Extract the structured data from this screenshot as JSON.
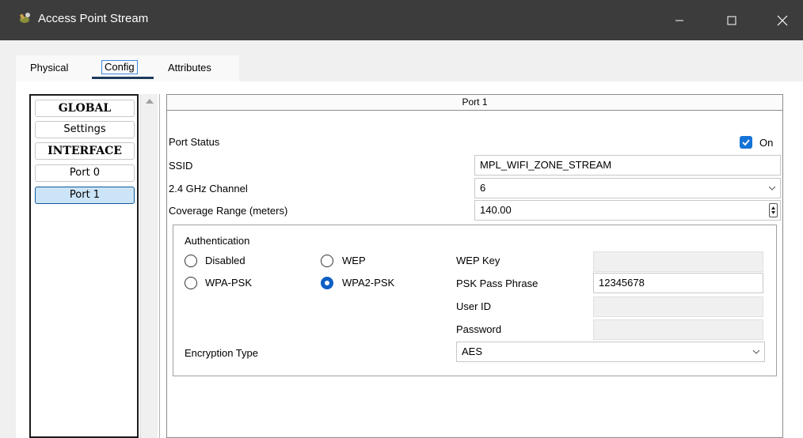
{
  "window": {
    "title": "Access Point Stream"
  },
  "tabs": [
    {
      "label": "Physical"
    },
    {
      "label": "Config"
    },
    {
      "label": "Attributes"
    }
  ],
  "sidebar": {
    "items": [
      {
        "label": "GLOBAL"
      },
      {
        "label": "Settings"
      },
      {
        "label": "INTERFACE"
      },
      {
        "label": "Port 0"
      },
      {
        "label": "Port 1"
      }
    ]
  },
  "port": {
    "header": "Port 1",
    "status_label": "Port Status",
    "status_value": "On",
    "ssid_label": "SSID",
    "ssid_value": "MPL_WIFI_ZONE_STREAM",
    "channel_label": "2.4 GHz Channel",
    "channel_value": "6",
    "coverage_label": "Coverage Range (meters)",
    "coverage_value": "140.00"
  },
  "auth": {
    "title": "Authentication",
    "options": {
      "disabled": "Disabled",
      "wep": "WEP",
      "wpa_psk": "WPA-PSK",
      "wpa2_psk": "WPA2-PSK"
    },
    "selected": "WPA2-PSK",
    "wep_key_label": "WEP Key",
    "wep_key_value": "",
    "psk_label": "PSK Pass Phrase",
    "psk_value": "12345678",
    "user_id_label": "User ID",
    "user_id_value": "",
    "password_label": "Password",
    "password_value": "",
    "encryption_label": "Encryption Type",
    "encryption_value": "AES"
  },
  "colors": {
    "titlebar": "#3c3c3c",
    "accent": "#1473d6",
    "selected_item": "#cce4f7"
  }
}
